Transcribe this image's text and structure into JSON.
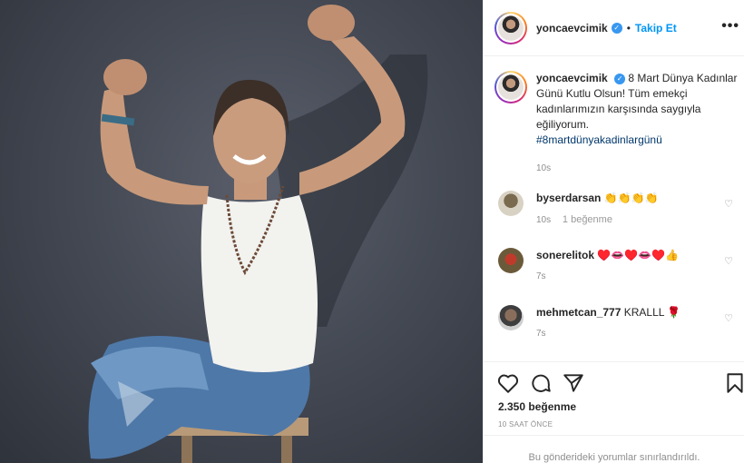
{
  "header": {
    "username": "yoncaevcimik",
    "separator": "•",
    "follow_label": "Takip Et",
    "more_icon": "more-options-icon"
  },
  "caption": {
    "username": "yoncaevcimik",
    "text": "8 Mart Dünya Kadınlar Günü Kutlu Olsun! Tüm emekçi kadınlarımızın karşısında saygıyla eğiliyorum.",
    "hashtag": "#8martdünyakadinlargünü",
    "time": "10s"
  },
  "comments": [
    {
      "username": "byserdarsan",
      "text": "👏👏👏👏",
      "time": "10s",
      "likes": "1 beğenme"
    },
    {
      "username": "sonerelitok",
      "text": "♥️👄♥️👄♥️👍",
      "time": "7s",
      "likes": ""
    },
    {
      "username": "mehmetcan_777",
      "text": "KRALLL 🌹",
      "time": "7s",
      "likes": ""
    }
  ],
  "actions": {
    "likes_count": "2.350 beğenme",
    "posted_ago": "10 SAAT ÖNCE",
    "comments_restricted": "Bu gönderideki yorumlar sınırlandırıldı."
  },
  "colors": {
    "link": "#0095f6",
    "verified": "#3897f0",
    "muted": "#8e8e8e"
  }
}
